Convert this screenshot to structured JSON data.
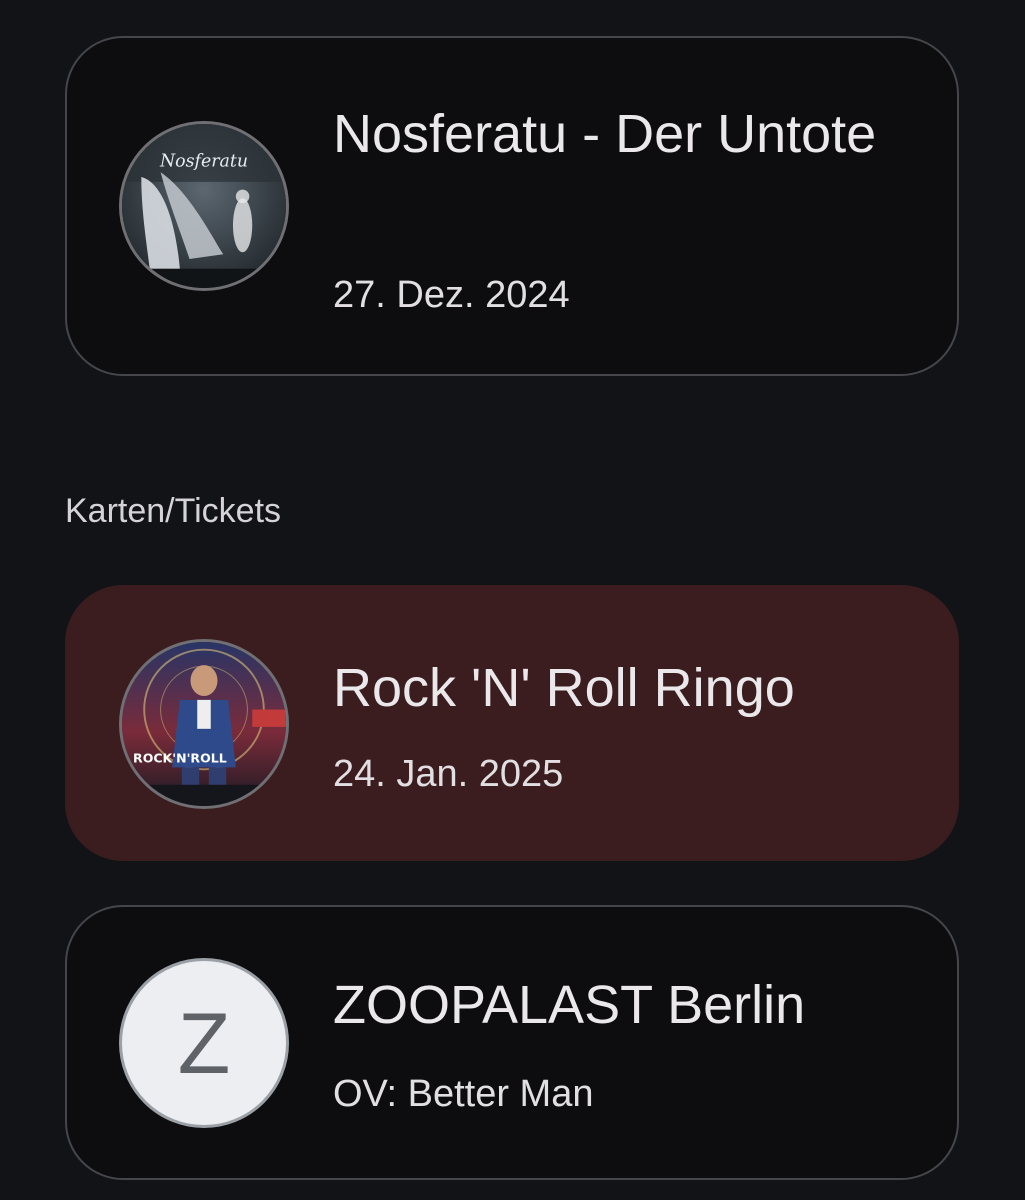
{
  "events": [
    {
      "title": "Nosferatu - Der Untote",
      "subtitle": "27. Dez. 2024",
      "poster_text": "Nosferatu"
    }
  ],
  "section": {
    "label": "Karten/Tickets"
  },
  "tickets": [
    {
      "title": "Rock 'N' Roll Ringo",
      "subtitle": "24. Jan. 2025",
      "poster_text": "ROCK'N'ROLL"
    },
    {
      "title": "ZOOPALAST Berlin",
      "subtitle": "OV: Better Man",
      "avatar_letter": "Z"
    }
  ],
  "colors": {
    "background": "#121316",
    "highlight_card": "#3b1d1f",
    "card_border": "#45464c"
  }
}
